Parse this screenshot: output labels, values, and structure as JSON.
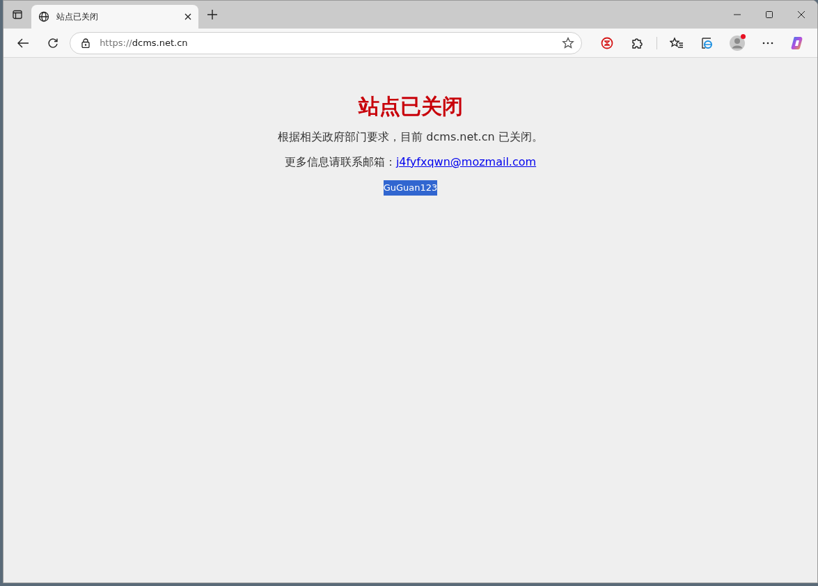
{
  "browser": {
    "tabs": [
      {
        "title": "站点已关闭",
        "selected": true
      }
    ],
    "address": {
      "scheme": "https://",
      "host": "dcms.net.cn"
    },
    "profile": {
      "notification": true
    }
  },
  "page": {
    "heading": "站点已关闭",
    "notice": "根据相关政府部门要求，目前 dcms.net.cn 已关闭。",
    "contact_label": "更多信息请联系邮箱：",
    "contact_email": "j4fyfxqwn@mozmail.com",
    "footer_text": "GuGuan123",
    "footer_selected": true
  }
}
